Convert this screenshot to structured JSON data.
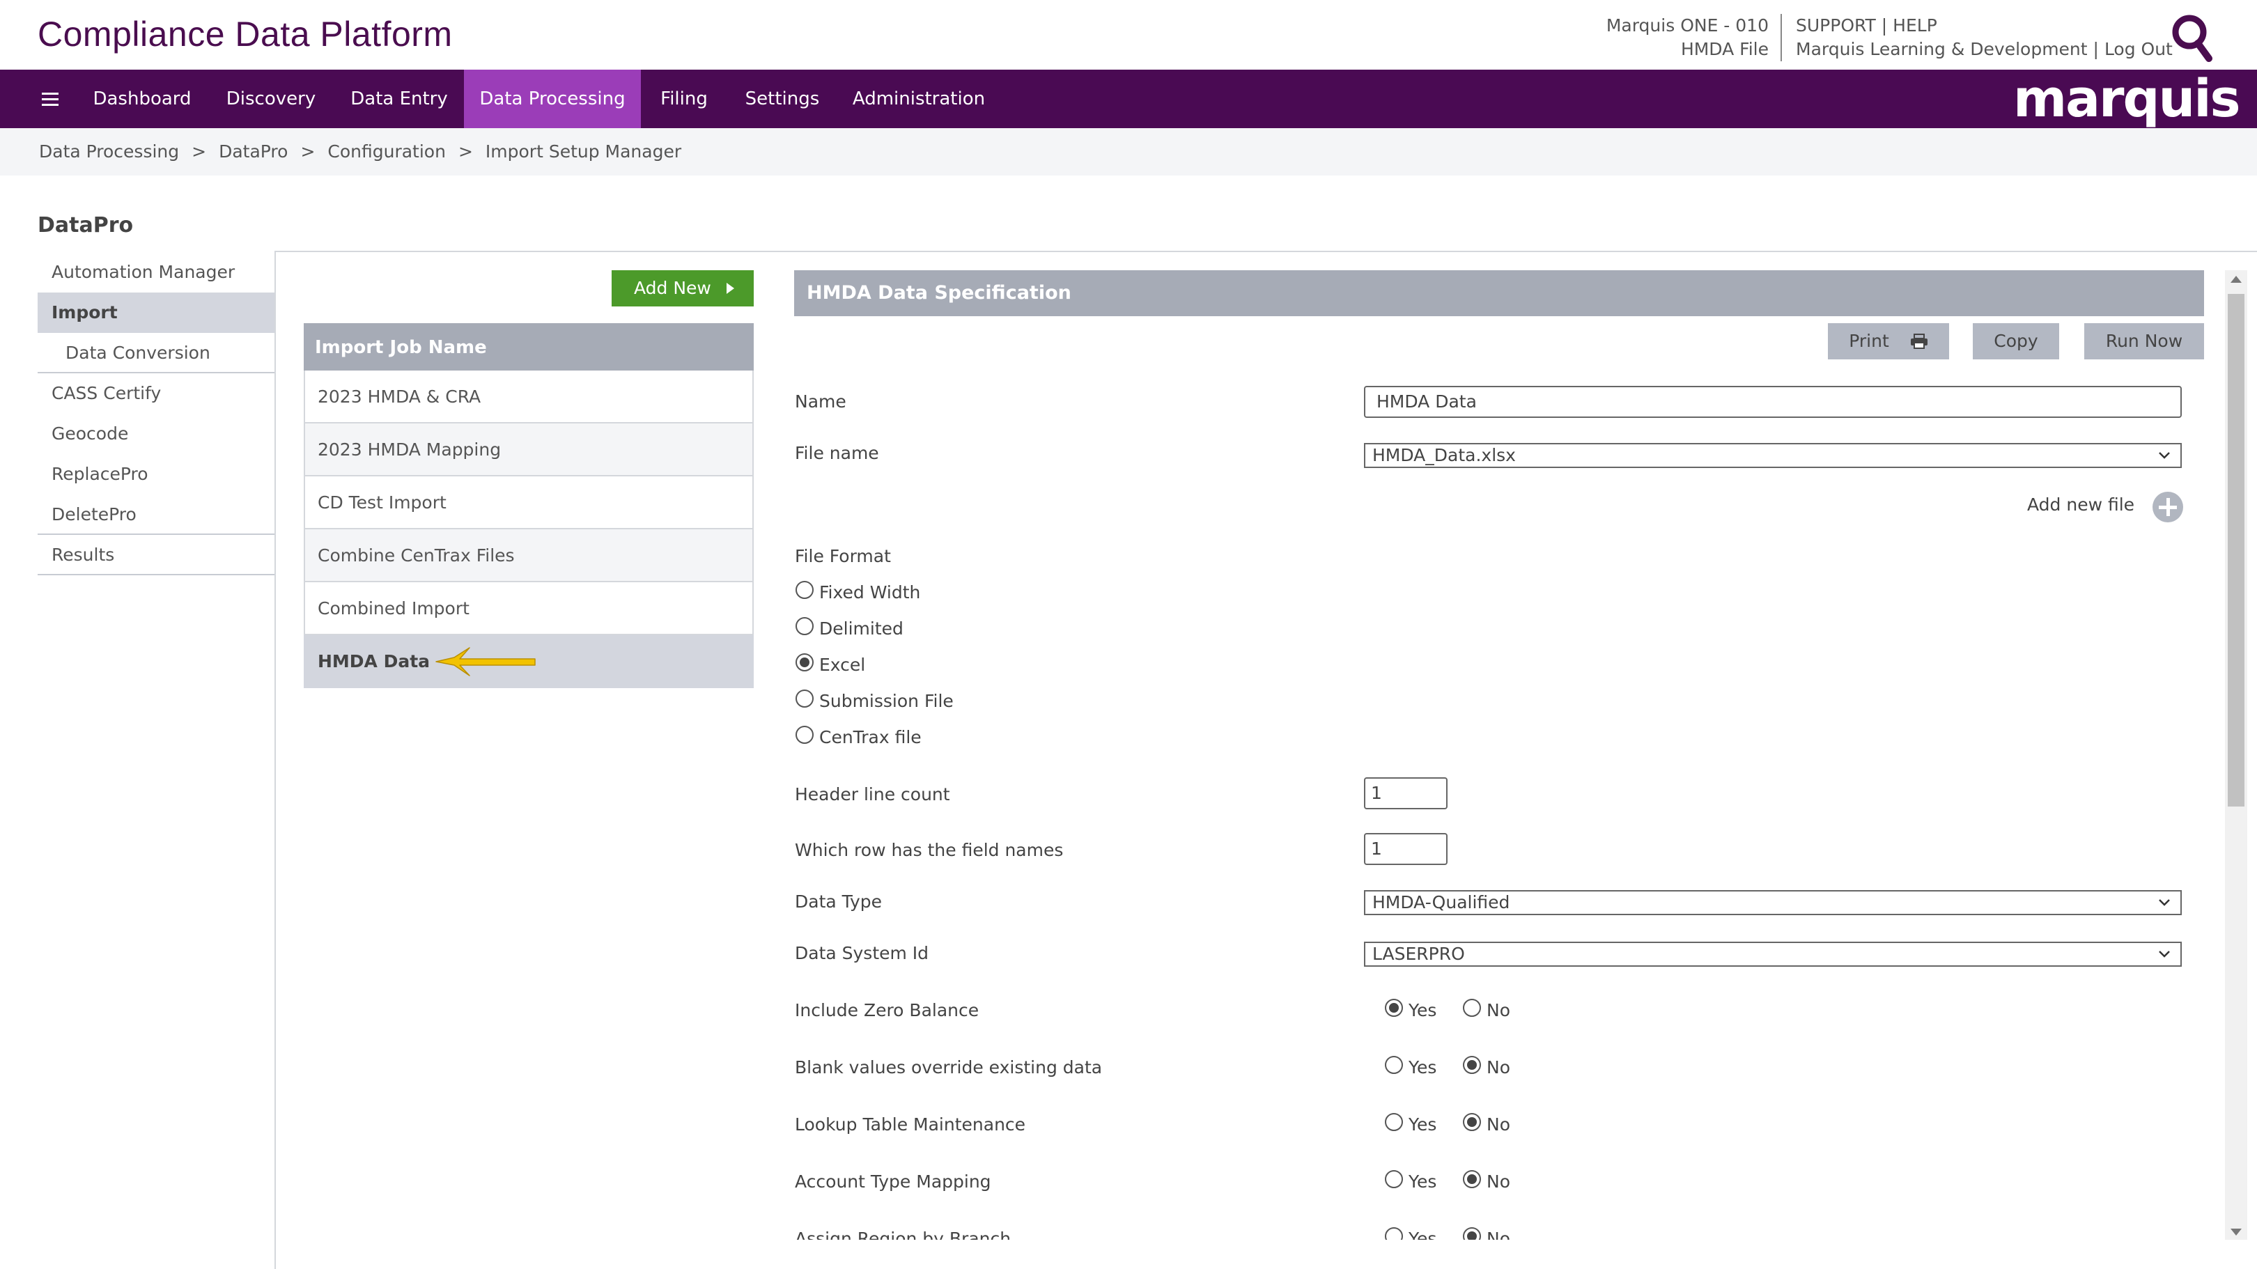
{
  "header": {
    "app_title": "Compliance Data Platform",
    "account_line1": "Marquis ONE - 010",
    "account_line2": "HMDA File",
    "support": "SUPPORT",
    "help": "HELP",
    "org": "Marquis Learning & Development",
    "logout": "Log Out",
    "pipe": "|"
  },
  "nav": {
    "items": [
      "Dashboard",
      "Discovery",
      "Data Entry",
      "Data Processing",
      "Filing",
      "Settings",
      "Administration"
    ],
    "active": "Data Processing",
    "brand": "marquis"
  },
  "breadcrumb": [
    "Data Processing",
    "DataPro",
    "Configuration",
    "Import Setup Manager"
  ],
  "breadcrumb_sep": ">",
  "sidebar": {
    "title": "DataPro",
    "items": [
      "Automation Manager",
      "Import",
      "Data Conversion",
      "CASS Certify",
      "Geocode",
      "ReplacePro",
      "DeletePro",
      "Results"
    ]
  },
  "jobs": {
    "add_new": "Add New",
    "header": "Import Job Name",
    "items": [
      "2023 HMDA & CRA",
      "2023 HMDA Mapping",
      "CD Test Import",
      "Combine CenTrax Files",
      "Combined Import",
      "HMDA Data"
    ],
    "selected": "HMDA Data"
  },
  "spec": {
    "title": "HMDA Data Specification",
    "print": "Print",
    "copy": "Copy",
    "run_now": "Run Now",
    "name_label": "Name",
    "name_value": "HMDA Data",
    "file_name_label": "File name",
    "file_name_value": "HMDA_Data.xlsx",
    "add_new_file": "Add new file",
    "file_format_label": "File Format",
    "file_formats": [
      "Fixed Width",
      "Delimited",
      "Excel",
      "Submission File",
      "CenTrax file"
    ],
    "file_format_selected": "Excel",
    "header_line_count_label": "Header line count",
    "header_line_count": "1",
    "field_names_row_label": "Which row has the field names",
    "field_names_row": "1",
    "data_type_label": "Data Type",
    "data_type_value": "HMDA-Qualified",
    "data_system_label": "Data System Id",
    "data_system_value": "LASERPRO",
    "yes": "Yes",
    "no": "No",
    "toggles": [
      {
        "label": "Include Zero Balance",
        "value": "Yes"
      },
      {
        "label": "Blank values override existing data",
        "value": "No"
      },
      {
        "label": "Lookup Table Maintenance",
        "value": "No"
      },
      {
        "label": "Account Type Mapping",
        "value": "No"
      },
      {
        "label": "Assign Region by Branch",
        "value": "No"
      }
    ]
  },
  "colors": {
    "nav_bg": "#4a0a53",
    "nav_active": "#9b3db8",
    "title": "#4a0d4f",
    "add_new": "#4c9a2a",
    "table_head": "#a6abb6",
    "selected_row": "#d3d6de",
    "arrow": "#f2c200"
  },
  "icons": [
    "search-icon",
    "hamburger-icon",
    "printer-icon",
    "plus-circle-icon",
    "chevron-down-icon",
    "arrow-left-icon"
  ]
}
